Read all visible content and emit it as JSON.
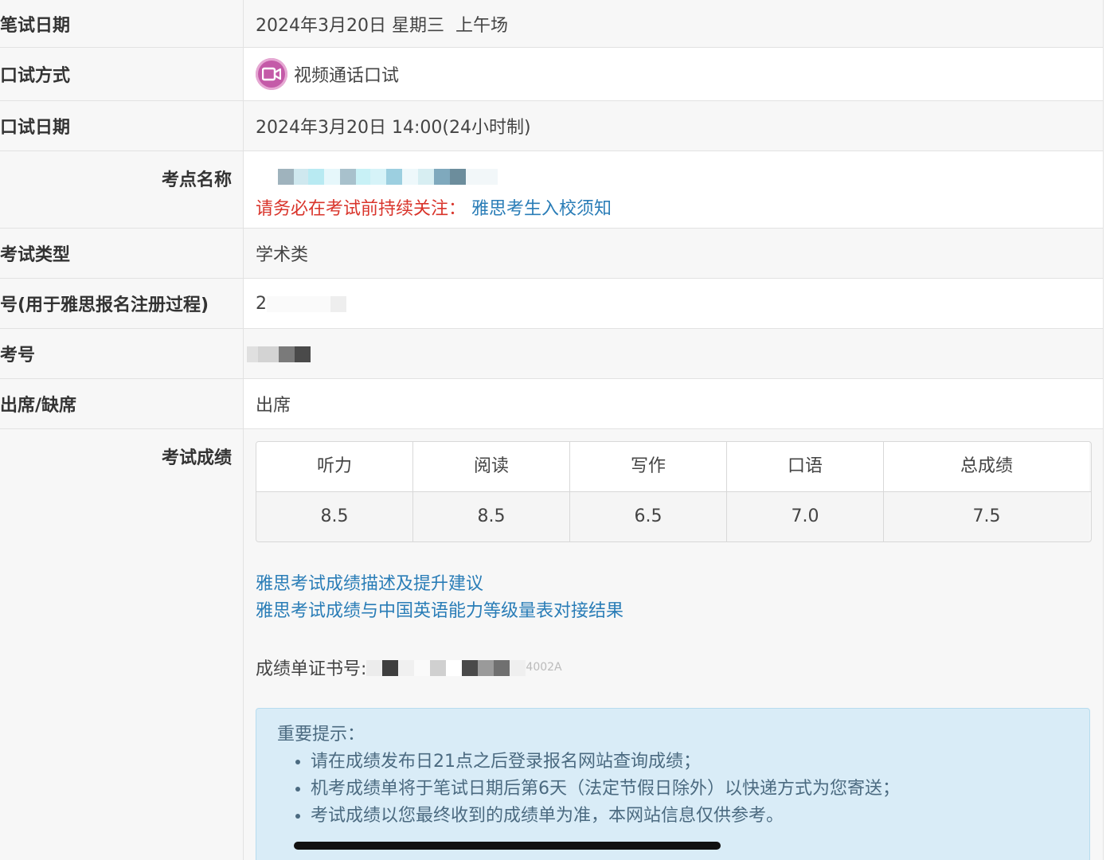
{
  "rows": {
    "written_date": {
      "label": "笔试日期",
      "value": "2024年3月20日 星期三  上午场"
    },
    "speaking_mode": {
      "label": "口试方式",
      "value": "视频通话口试",
      "icon": "video-call-icon"
    },
    "speaking_date": {
      "label": "口试日期",
      "value": "2024年3月20日 14:00(24小时制)"
    },
    "test_center": {
      "label": "考点名称",
      "notice": "请务必在考试前持续关注：",
      "link": "雅思考生入校须知"
    },
    "test_type": {
      "label": "考试类型",
      "value": "学术类"
    },
    "reg_number": {
      "label": "号(用于雅思报名注册过程)",
      "value": "2"
    },
    "candidate_no": {
      "label": "考号",
      "value": ""
    },
    "attendance": {
      "label": "出席/缺席",
      "value": "出席"
    },
    "scores_label": "考试成绩"
  },
  "scores": {
    "headers": [
      "听力",
      "阅读",
      "写作",
      "口语",
      "总成绩"
    ],
    "values": [
      "8.5",
      "8.5",
      "6.5",
      "7.0",
      "7.5"
    ]
  },
  "links": {
    "desc": "雅思考试成绩描述及提升建议",
    "mapping": "雅思考试成绩与中国英语能力等级量表对接结果"
  },
  "certificate": {
    "label": "成绩单证书号:",
    "value_suffix": "4002A"
  },
  "tips": {
    "title": "重要提示：",
    "items": [
      "请在成绩发布日21点之后登录报名网站查询成绩；",
      "机考成绩单将于笔试日期后第6天（法定节假日除外）以快递方式为您寄送；",
      "考试成绩以您最终收到的成绩单为准，本网站信息仅供参考。"
    ]
  },
  "colors": {
    "link": "#2a7db7",
    "notice": "#d9342b",
    "tip_bg": "#d9ecf7"
  }
}
